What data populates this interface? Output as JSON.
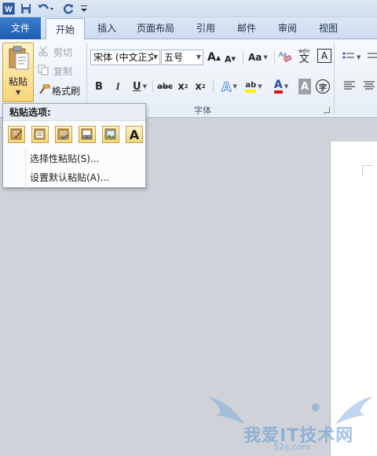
{
  "quick_access": {
    "word_icon": "word-app-icon",
    "save_icon": "save-icon",
    "undo_icon": "undo-icon",
    "redo_icon": "redo-icon",
    "customize_icon": "customize-qat-icon"
  },
  "tabs": {
    "file": "文件",
    "home": "开始",
    "insert": "插入",
    "page_layout": "页面布局",
    "references": "引用",
    "mailings": "邮件",
    "review": "审阅",
    "view": "视图"
  },
  "clipboard": {
    "paste_label": "粘贴",
    "cut_label": "剪切",
    "copy_label": "复制",
    "format_painter_label": "格式刷"
  },
  "font": {
    "font_name": "宋体 (中文正文",
    "font_size": "五号",
    "group_label": "字体",
    "grow_label": "A",
    "shrink_label": "A",
    "change_case_label": "Aa",
    "pinyin_label": "wén",
    "bold": "B",
    "italic": "I",
    "underline": "U",
    "strikethrough": "abc",
    "subscript": "x",
    "superscript": "x",
    "font_color_label": "A",
    "char_shading_label": "A",
    "enclose_label": "字",
    "highlight_label": "ab"
  },
  "paste_menu": {
    "header": "粘贴选项:",
    "paste_special": "选择性粘贴(S)...",
    "set_default_paste": "设置默认粘贴(A)...",
    "text_only_label": "A"
  },
  "colors": {
    "file_tab": "#2a6fc9",
    "highlight": "#ffef00",
    "font_color": "#e0141e"
  },
  "watermark": {
    "text": "我爱IT技术网",
    "url": "52ij.com"
  }
}
